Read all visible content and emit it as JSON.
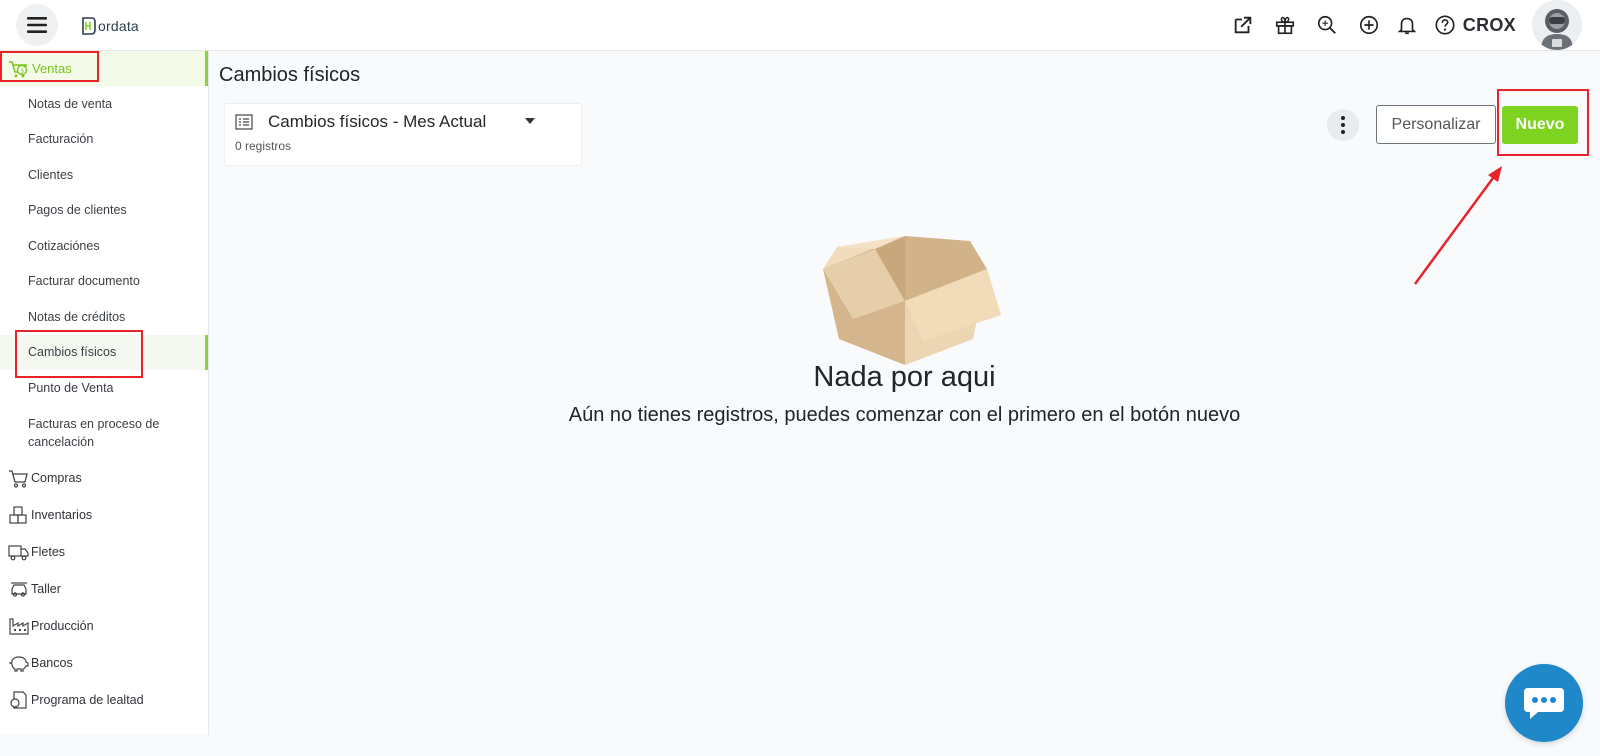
{
  "app": {
    "logo_text": "ordata",
    "user_name": "CROX"
  },
  "sidebar": {
    "section_ventas": "Ventas",
    "sub_items": [
      {
        "label": "Notas de venta"
      },
      {
        "label": "Facturación"
      },
      {
        "label": "Clientes"
      },
      {
        "label": "Pagos de clientes"
      },
      {
        "label": "Cotizaciónes"
      },
      {
        "label": "Facturar documento"
      },
      {
        "label": "Notas de créditos"
      },
      {
        "label": "Cambios físicos"
      },
      {
        "label": "Punto de Venta"
      },
      {
        "label": "Facturas en proceso de cancelación"
      }
    ],
    "groups": [
      {
        "label": "Compras",
        "icon": "cart-icon"
      },
      {
        "label": "Inventarios",
        "icon": "boxes-icon"
      },
      {
        "label": "Fletes",
        "icon": "truck-icon"
      },
      {
        "label": "Taller",
        "icon": "car-icon"
      },
      {
        "label": "Producción",
        "icon": "factory-icon"
      },
      {
        "label": "Bancos",
        "icon": "piggy-bank-icon"
      },
      {
        "label": "Programa de lealtad",
        "icon": "loyalty-icon"
      }
    ]
  },
  "main": {
    "page_title": "Cambios físicos",
    "view_name": "Cambios físicos - Mes Actual",
    "record_count": "0 registros",
    "btn_customize": "Personalizar",
    "btn_new": "Nuevo",
    "empty_title": "Nada por aqui",
    "empty_desc": "Aún no tienes registros, puedes comenzar con el primero en el botón nuevo"
  },
  "colors": {
    "accent_green": "#7ed321",
    "highlight_red": "#e8232a",
    "chat_blue": "#1e88c8"
  }
}
